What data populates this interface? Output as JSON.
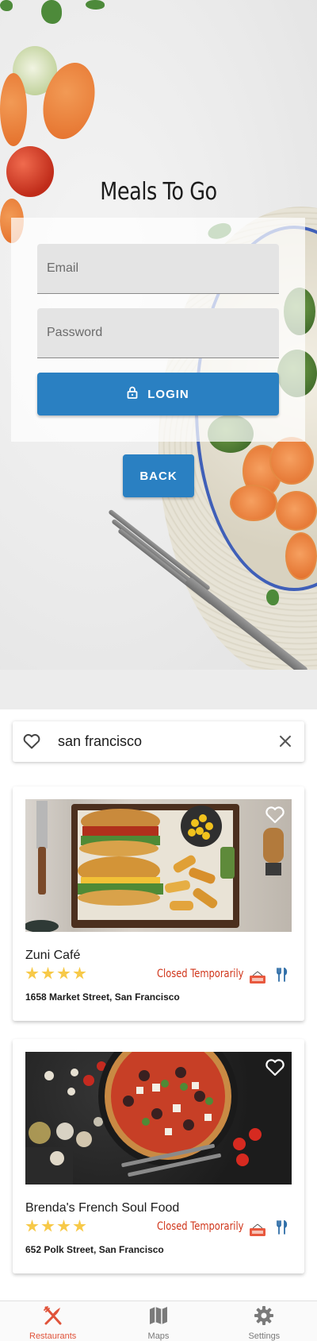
{
  "login": {
    "title": "Meals To Go",
    "email_label": "Email",
    "password_label": "Password",
    "login_label": "LOGIN",
    "login_icon": "lock-icon",
    "back_label": "BACK"
  },
  "search": {
    "value": "san francisco",
    "favourite_icon": "heart-outline-icon",
    "clear_icon": "close-icon"
  },
  "restaurants": [
    {
      "name": "Zuni Café",
      "rating": 4,
      "status": "Closed Temporarily",
      "address": "1658 Market Street, San Francisco",
      "photo": "burgers-and-fries-photo"
    },
    {
      "name": "Brenda's French Soul Food",
      "rating": 4,
      "status": "Closed Temporarily",
      "address": "652 Polk Street, San Francisco",
      "photo": "pizza-photo"
    }
  ],
  "tabs": [
    {
      "label": "Restaurants",
      "icon": "utensils-crossed-icon",
      "active": true
    },
    {
      "label": "Maps",
      "icon": "map-icon",
      "active": false
    },
    {
      "label": "Settings",
      "icon": "gear-icon",
      "active": false
    }
  ],
  "colors": {
    "primary": "#2a80c2",
    "status_red": "#d0351a",
    "star_gold": "#f7c948",
    "tab_active": "#e0533a",
    "tab_inactive": "#7a7a7a"
  }
}
